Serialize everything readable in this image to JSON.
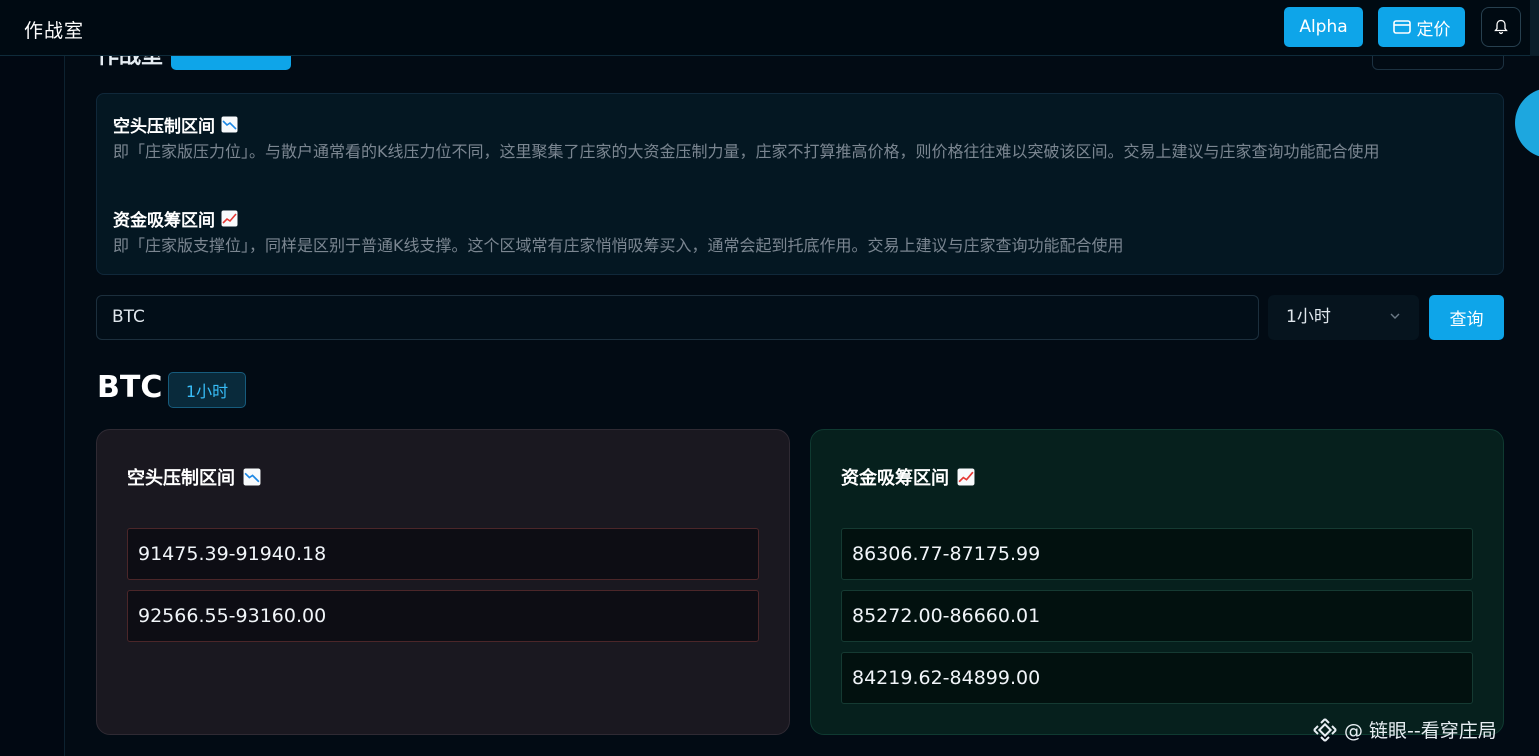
{
  "header": {
    "title": "作战室",
    "alpha_label": "Alpha",
    "pricing_label": "定价"
  },
  "info": {
    "short_title": "空头压制区间",
    "short_desc": "即「庄家版压力位」。与散户通常看的K线压力位不同，这里聚集了庄家的大资金压制力量，庄家不打算推高价格，则价格往往难以突破该区间。交易上建议与庄家查询功能配合使用",
    "long_title": "资金吸筹区间",
    "long_desc": "即「庄家版支撑位」，同样是区别于普通K线支撑。这个区域常有庄家悄悄吸筹买入，通常会起到托底作用。交易上建议与庄家查询功能配合使用"
  },
  "query": {
    "symbol_value": "BTC",
    "timeframe_value": "1小时",
    "button_label": "查询"
  },
  "result": {
    "symbol": "BTC",
    "timeframe_badge": "1小时",
    "short_panel": {
      "title": "空头压制区间",
      "zones": [
        "91475.39-91940.18",
        "92566.55-93160.00"
      ]
    },
    "long_panel": {
      "title": "资金吸筹区间",
      "zones": [
        "86306.77-87175.99",
        "85272.00-86660.01",
        "84219.62-84899.00"
      ]
    }
  },
  "watermark": "@ 链眼--看穿庄局",
  "icons": {
    "pricing": "card-icon",
    "bell": "bell-icon",
    "chevron": "chevron-down-icon",
    "chart_down": "chart-down-icon",
    "chart_up": "chart-up-icon",
    "watermark_logo": "binance-logo-icon"
  },
  "colors": {
    "accent": "#0ea5e9",
    "short_border": "#4b2629",
    "long_border": "#153a32"
  }
}
